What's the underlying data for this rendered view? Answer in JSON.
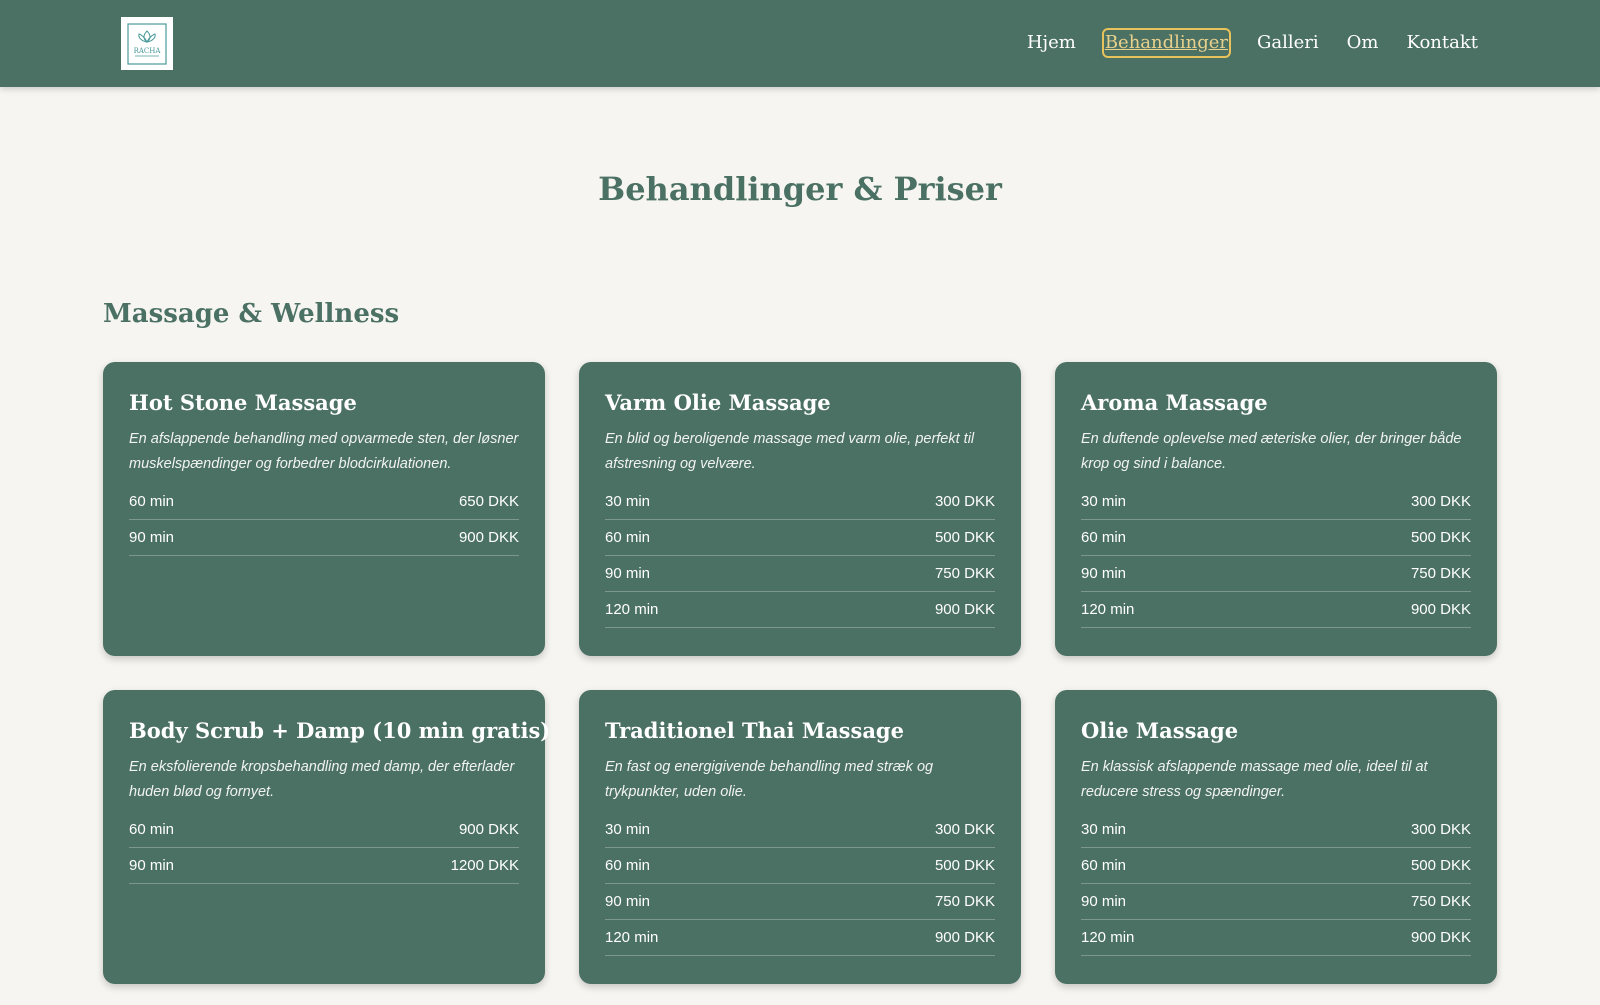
{
  "brand": {
    "logo_text": "RACHA"
  },
  "nav": {
    "items": [
      {
        "label": "Hjem"
      },
      {
        "label": "Behandlinger"
      },
      {
        "label": "Galleri"
      },
      {
        "label": "Om"
      },
      {
        "label": "Kontakt"
      }
    ],
    "active": "Behandlinger"
  },
  "page": {
    "title": "Behandlinger & Priser"
  },
  "section": {
    "title": "Massage & Wellness"
  },
  "treatments": [
    {
      "name": "Hot Stone Massage",
      "description": "En afslappende behandling med opvarmede sten, der løsner muskelspændinger og forbedrer blodcirkulationen.",
      "prices": [
        {
          "duration": "60 min",
          "price": "650 DKK"
        },
        {
          "duration": "90 min",
          "price": "900 DKK"
        }
      ]
    },
    {
      "name": "Varm Olie Massage",
      "description": "En blid og beroligende massage med varm olie, perfekt til afstresning og velvære.",
      "prices": [
        {
          "duration": "30 min",
          "price": "300 DKK"
        },
        {
          "duration": "60 min",
          "price": "500 DKK"
        },
        {
          "duration": "90 min",
          "price": "750 DKK"
        },
        {
          "duration": "120 min",
          "price": "900 DKK"
        }
      ]
    },
    {
      "name": "Aroma Massage",
      "description": "En duftende oplevelse med æteriske olier, der bringer både krop og sind i balance.",
      "prices": [
        {
          "duration": "30 min",
          "price": "300 DKK"
        },
        {
          "duration": "60 min",
          "price": "500 DKK"
        },
        {
          "duration": "90 min",
          "price": "750 DKK"
        },
        {
          "duration": "120 min",
          "price": "900 DKK"
        }
      ]
    },
    {
      "name": "Body Scrub + Damp (10 min gratis)",
      "description": "En eksfolierende kropsbehandling med damp, der efterlader huden blød og fornyet.",
      "prices": [
        {
          "duration": "60 min",
          "price": "900 DKK"
        },
        {
          "duration": "90 min",
          "price": "1200 DKK"
        }
      ]
    },
    {
      "name": "Traditionel Thai Massage",
      "description": "En fast og energigivende behandling med stræk og trykpunkter, uden olie.",
      "prices": [
        {
          "duration": "30 min",
          "price": "300 DKK"
        },
        {
          "duration": "60 min",
          "price": "500 DKK"
        },
        {
          "duration": "90 min",
          "price": "750 DKK"
        },
        {
          "duration": "120 min",
          "price": "900 DKK"
        }
      ]
    },
    {
      "name": "Olie Massage",
      "description": "En klassisk afslappende massage med olie, ideel til at reducere stress og spændinger.",
      "prices": [
        {
          "duration": "30 min",
          "price": "300 DKK"
        },
        {
          "duration": "60 min",
          "price": "500 DKK"
        },
        {
          "duration": "90 min",
          "price": "750 DKK"
        },
        {
          "duration": "120 min",
          "price": "900 DKK"
        }
      ]
    }
  ],
  "colors": {
    "primary": "#4b7064",
    "background": "#f6f5f1",
    "accent": "#e8c25a",
    "text_on_primary": "#ffffff"
  }
}
